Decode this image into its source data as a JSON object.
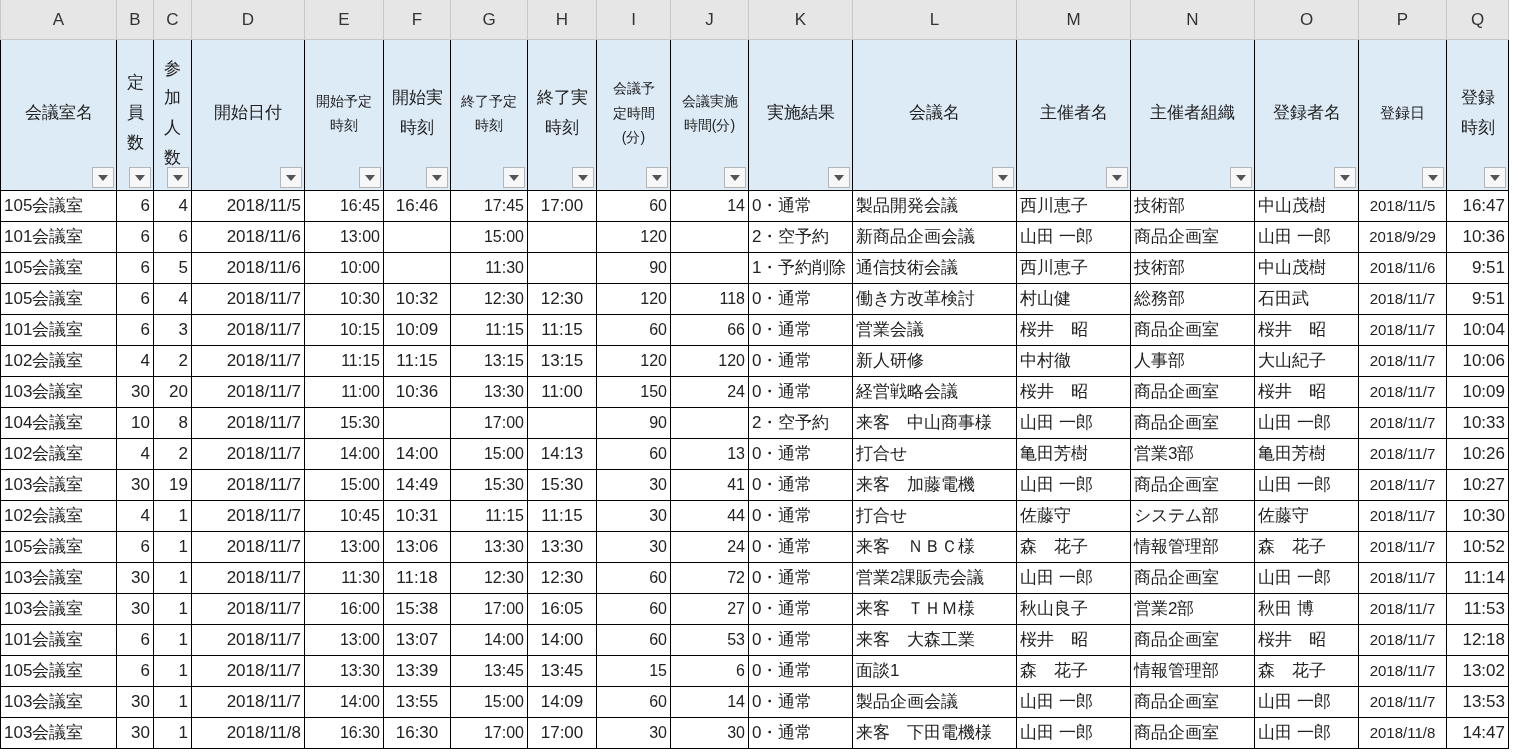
{
  "columns": [
    {
      "letter": "A",
      "header": "会議室名"
    },
    {
      "letter": "B",
      "header": "定員数"
    },
    {
      "letter": "C",
      "header": "参加人数"
    },
    {
      "letter": "D",
      "header": "開始日付"
    },
    {
      "letter": "E",
      "header": "開始予定時刻"
    },
    {
      "letter": "F",
      "header": "開始実時刻"
    },
    {
      "letter": "G",
      "header": "終了予定時刻"
    },
    {
      "letter": "H",
      "header": "終了実時刻"
    },
    {
      "letter": "I",
      "header": "会議予定時間(分)"
    },
    {
      "letter": "J",
      "header": "会議実施時間(分)"
    },
    {
      "letter": "K",
      "header": "実施結果"
    },
    {
      "letter": "L",
      "header": "会議名"
    },
    {
      "letter": "M",
      "header": "主催者名"
    },
    {
      "letter": "N",
      "header": "主催者組織"
    },
    {
      "letter": "O",
      "header": "登録者名"
    },
    {
      "letter": "P",
      "header": "登録日"
    },
    {
      "letter": "Q",
      "header": "登録時刻"
    }
  ],
  "rows": [
    [
      "105会議室",
      "6",
      "4",
      "2018/11/5",
      "16:45",
      "16:46",
      "17:45",
      "17:00",
      "60",
      "14",
      "0・通常",
      "製品開発会議",
      "西川恵子",
      "技術部",
      "中山茂樹",
      "2018/11/5",
      "16:47"
    ],
    [
      "101会議室",
      "6",
      "6",
      "2018/11/6",
      "13:00",
      null,
      "15:00",
      null,
      "120",
      null,
      "2・空予約",
      "新商品企画会議",
      "山田 一郎",
      "商品企画室",
      "山田 一郎",
      "2018/9/29",
      "10:36"
    ],
    [
      "105会議室",
      "6",
      "5",
      "2018/11/6",
      "10:00",
      null,
      "11:30",
      null,
      "90",
      null,
      "1・予約削除",
      "通信技術会議",
      "西川恵子",
      "技術部",
      "中山茂樹",
      "2018/11/6",
      "9:51"
    ],
    [
      "105会議室",
      "6",
      "4",
      "2018/11/7",
      "10:30",
      "10:32",
      "12:30",
      "12:30",
      "120",
      "118",
      "0・通常",
      "働き方改革検討",
      "村山健",
      "総務部",
      "石田武",
      "2018/11/7",
      "9:51"
    ],
    [
      "101会議室",
      "6",
      "3",
      "2018/11/7",
      "10:15",
      "10:09",
      "11:15",
      "11:15",
      "60",
      "66",
      "0・通常",
      "営業会議",
      "桜井　昭",
      "商品企画室",
      "桜井　昭",
      "2018/11/7",
      "10:04"
    ],
    [
      "102会議室",
      "4",
      "2",
      "2018/11/7",
      "11:15",
      "11:15",
      "13:15",
      "13:15",
      "120",
      "120",
      "0・通常",
      "新人研修",
      "中村徹",
      "人事部",
      "大山紀子",
      "2018/11/7",
      "10:06"
    ],
    [
      "103会議室",
      "30",
      "20",
      "2018/11/7",
      "11:00",
      "10:36",
      "13:30",
      "11:00",
      "150",
      "24",
      "0・通常",
      "経営戦略会議",
      "桜井　昭",
      "商品企画室",
      "桜井　昭",
      "2018/11/7",
      "10:09"
    ],
    [
      "104会議室",
      "10",
      "8",
      "2018/11/7",
      "15:30",
      null,
      "17:00",
      null,
      "90",
      null,
      "2・空予約",
      "来客　中山商事様",
      "山田 一郎",
      "商品企画室",
      "山田 一郎",
      "2018/11/7",
      "10:33"
    ],
    [
      "102会議室",
      "4",
      "2",
      "2018/11/7",
      "14:00",
      "14:00",
      "15:00",
      "14:13",
      "60",
      "13",
      "0・通常",
      "打合せ",
      "亀田芳樹",
      "営業3部",
      "亀田芳樹",
      "2018/11/7",
      "10:26"
    ],
    [
      "103会議室",
      "30",
      "19",
      "2018/11/7",
      "15:00",
      "14:49",
      "15:30",
      "15:30",
      "30",
      "41",
      "0・通常",
      "来客　加藤電機",
      "山田 一郎",
      "商品企画室",
      "山田 一郎",
      "2018/11/7",
      "10:27"
    ],
    [
      "102会議室",
      "4",
      "1",
      "2018/11/7",
      "10:45",
      "10:31",
      "11:15",
      "11:15",
      "30",
      "44",
      "0・通常",
      "打合せ",
      "佐藤守",
      "システム部",
      "佐藤守",
      "2018/11/7",
      "10:30"
    ],
    [
      "105会議室",
      "6",
      "1",
      "2018/11/7",
      "13:00",
      "13:06",
      "13:30",
      "13:30",
      "30",
      "24",
      "0・通常",
      "来客　ＮＢＣ様",
      "森　花子",
      "情報管理部",
      "森　花子",
      "2018/11/7",
      "10:52"
    ],
    [
      "103会議室",
      "30",
      "1",
      "2018/11/7",
      "11:30",
      "11:18",
      "12:30",
      "12:30",
      "60",
      "72",
      "0・通常",
      "営業2課販売会議",
      "山田 一郎",
      "商品企画室",
      "山田 一郎",
      "2018/11/7",
      "11:14"
    ],
    [
      "103会議室",
      "30",
      "1",
      "2018/11/7",
      "16:00",
      "15:38",
      "17:00",
      "16:05",
      "60",
      "27",
      "0・通常",
      "来客　ＴＨＭ様",
      "秋山良子",
      "営業2部",
      "秋田 博",
      "2018/11/7",
      "11:53"
    ],
    [
      "101会議室",
      "6",
      "1",
      "2018/11/7",
      "13:00",
      "13:07",
      "14:00",
      "14:00",
      "60",
      "53",
      "0・通常",
      "来客　大森工業",
      "桜井　昭",
      "商品企画室",
      "桜井　昭",
      "2018/11/7",
      "12:18"
    ],
    [
      "105会議室",
      "6",
      "1",
      "2018/11/7",
      "13:30",
      "13:39",
      "13:45",
      "13:45",
      "15",
      "6",
      "0・通常",
      "面談1",
      "森　花子",
      "情報管理部",
      "森　花子",
      "2018/11/7",
      "13:02"
    ],
    [
      "103会議室",
      "30",
      "1",
      "2018/11/7",
      "14:00",
      "13:55",
      "15:00",
      "14:09",
      "60",
      "14",
      "0・通常",
      "製品企画会議",
      "山田 一郎",
      "商品企画室",
      "山田 一郎",
      "2018/11/7",
      "13:53"
    ],
    [
      "103会議室",
      "30",
      "1",
      "2018/11/8",
      "16:30",
      "16:30",
      "17:00",
      "17:00",
      "30",
      "30",
      "0・通常",
      "来客　下田電機様",
      "山田 一郎",
      "商品企画室",
      "山田 一郎",
      "2018/11/8",
      "14:47"
    ]
  ]
}
